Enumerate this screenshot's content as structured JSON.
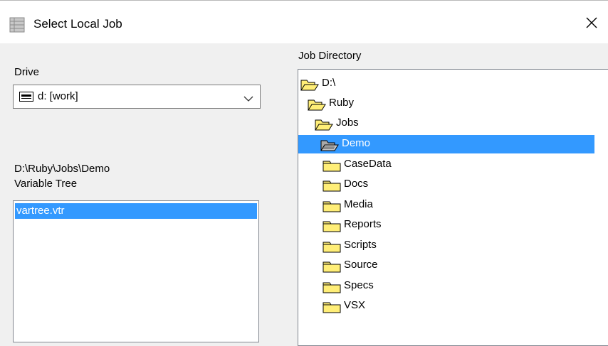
{
  "window": {
    "title": "Select Local Job",
    "close_glyph": "✕"
  },
  "drive": {
    "label": "Drive",
    "selected": "d: [work]",
    "icon": "drive-icon"
  },
  "current_path": "D:\\Ruby\\Jobs\\Demo",
  "variable_tree": {
    "label": "Variable Tree",
    "items": [
      "vartree.vtr"
    ],
    "selected_index": 0
  },
  "job_directory": {
    "label": "Job Directory",
    "items": [
      {
        "name": "D:\\",
        "icon": "open-folder-icon"
      },
      {
        "name": "Ruby",
        "icon": "open-folder-icon"
      },
      {
        "name": "Jobs",
        "icon": "open-folder-icon"
      },
      {
        "name": "Demo",
        "icon": "open-folder-selected-icon",
        "selected": true
      },
      {
        "name": "CaseData",
        "icon": "folder-icon"
      },
      {
        "name": "Docs",
        "icon": "folder-icon"
      },
      {
        "name": "Media",
        "icon": "folder-icon"
      },
      {
        "name": "Reports",
        "icon": "folder-icon"
      },
      {
        "name": "Scripts",
        "icon": "folder-icon"
      },
      {
        "name": "Source",
        "icon": "folder-icon"
      },
      {
        "name": "Specs",
        "icon": "folder-icon"
      },
      {
        "name": "VSX",
        "icon": "folder-icon"
      }
    ]
  },
  "colors": {
    "selection": "#3399ff",
    "folder_fill": "#ffee77",
    "folder_outline": "#000000",
    "dialog_bg": "#f0f0f0"
  }
}
